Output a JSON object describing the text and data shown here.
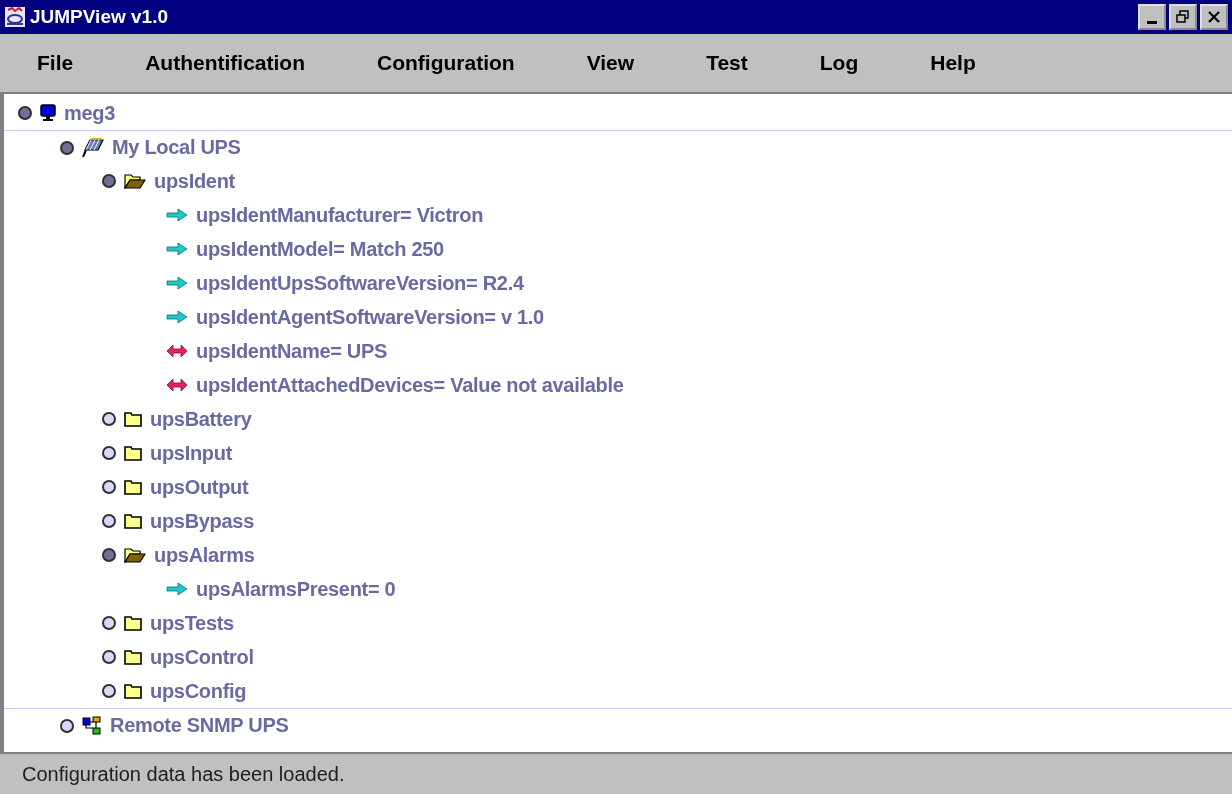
{
  "window": {
    "title": "JUMPView v1.0"
  },
  "menu": [
    "File",
    "Authentification",
    "Configuration",
    "View",
    "Test",
    "Log",
    "Help"
  ],
  "tree": [
    {
      "kind": "host",
      "label": "meg3",
      "expanded": true,
      "children": [
        {
          "kind": "ups",
          "label": "My Local UPS",
          "expanded": true,
          "children": [
            {
              "kind": "folder",
              "label": "upsIdent",
              "expanded": true,
              "children": [
                {
                  "kind": "readonly",
                  "label": "upsIdentManufacturer= Victron"
                },
                {
                  "kind": "readonly",
                  "label": "upsIdentModel= Match 250"
                },
                {
                  "kind": "readonly",
                  "label": "upsIdentUpsSoftwareVersion= R2.4"
                },
                {
                  "kind": "readonly",
                  "label": "upsIdentAgentSoftwareVersion= v 1.0"
                },
                {
                  "kind": "readwrite",
                  "label": "upsIdentName= UPS"
                },
                {
                  "kind": "readwrite",
                  "label": "upsIdentAttachedDevices= Value not available"
                }
              ]
            },
            {
              "kind": "folder",
              "label": "upsBattery",
              "expanded": false
            },
            {
              "kind": "folder",
              "label": "upsInput",
              "expanded": false
            },
            {
              "kind": "folder",
              "label": "upsOutput",
              "expanded": false
            },
            {
              "kind": "folder",
              "label": "upsBypass",
              "expanded": false
            },
            {
              "kind": "folder",
              "label": "upsAlarms",
              "expanded": true,
              "children": [
                {
                  "kind": "readonly",
                  "label": "upsAlarmsPresent= 0"
                }
              ]
            },
            {
              "kind": "folder",
              "label": "upsTests",
              "expanded": false
            },
            {
              "kind": "folder",
              "label": "upsControl",
              "expanded": false
            },
            {
              "kind": "folder",
              "label": "upsConfig",
              "expanded": false
            }
          ]
        },
        {
          "kind": "remote",
          "label": "Remote SNMP UPS",
          "expanded": false
        }
      ]
    }
  ],
  "status_bar": "Configuration data has been loaded."
}
